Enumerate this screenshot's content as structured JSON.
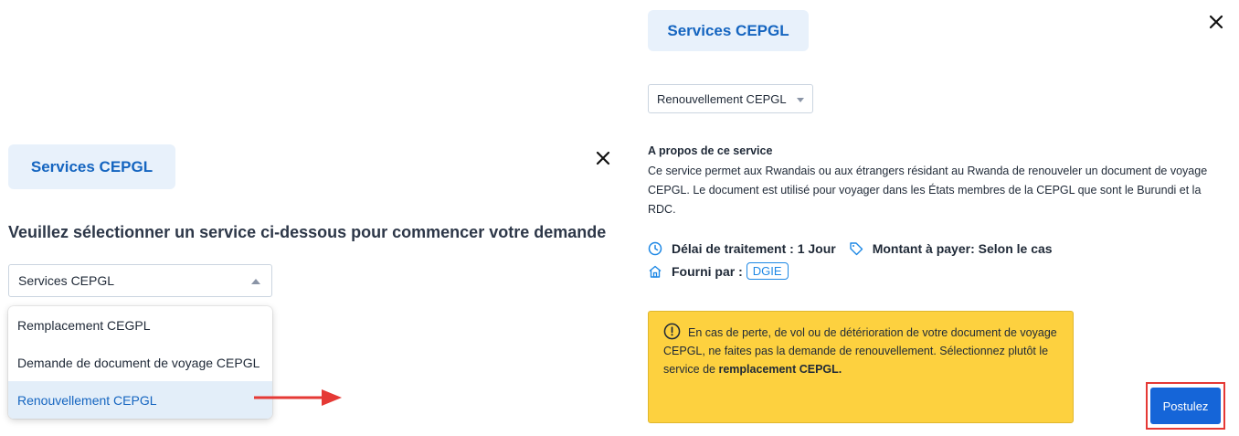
{
  "left_panel": {
    "title": "Services CEPGL",
    "heading": "Veuillez sélectionner un service ci-dessous pour commencer votre demande",
    "select_value": "Services CEPGL",
    "options": [
      {
        "label": "Remplacement CEGPL",
        "selected": false
      },
      {
        "label": "Demande de document de voyage CEPGL",
        "selected": false
      },
      {
        "label": "Renouvellement CEPGL",
        "selected": true
      }
    ],
    "close_icon": "close-icon"
  },
  "annotation": {
    "arrow_color": "#e53935"
  },
  "right_panel": {
    "title": "Services CEPGL",
    "select_value": "Renouvellement CEPGL",
    "about_title": "A propos de ce service",
    "about_text": "Ce service permet aux Rwandais ou aux étrangers résidant au Rwanda de renouveler un document de voyage CEPGL. Le document est utilisé pour voyager dans les États membres de la CEPGL que sont le Burundi et la RDC.",
    "processing_time": "Délai de traitement : 1 Jour",
    "amount": "Montant à payer: Selon le cas",
    "provided_by_label": "Fourni par :",
    "provider": "DGIE",
    "alert_text": "En cas de perte, de vol ou de détérioration de votre document de voyage CEPGL, ne faites pas la demande de renouvellement. Sélectionnez plutôt le service de",
    "alert_bold": "remplacement CEPGL.",
    "apply_label": "Postulez",
    "close_icon": "close-icon"
  },
  "colors": {
    "accent": "#1565d8",
    "title_bg": "#e8f1fb",
    "alert_bg": "#fdd13f",
    "highlight": "#e53935"
  }
}
